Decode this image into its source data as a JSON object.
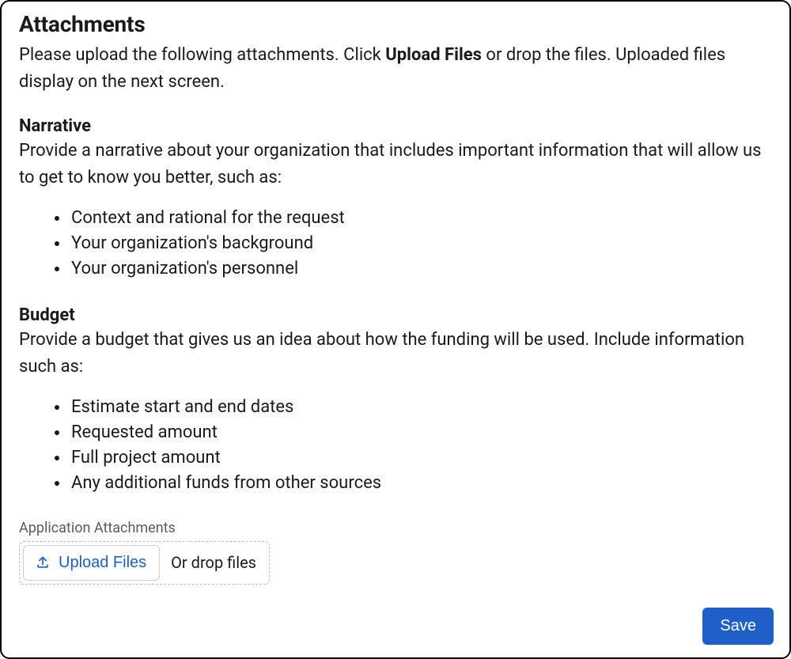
{
  "header": {
    "title": "Attachments",
    "intro_pre": "Please upload the following attachments. Click ",
    "intro_bold": "Upload Files",
    "intro_post": " or drop the files. Uploaded files display on the next screen."
  },
  "narrative": {
    "heading": "Narrative",
    "desc": "Provide a narrative about your organization that includes important information that will allow us to get to know you better, such as:",
    "bullets": [
      "Context and rational for the request",
      "Your organization's background",
      "Your organization's personnel"
    ]
  },
  "budget": {
    "heading": "Budget",
    "desc": "Provide a budget that gives us an idea about how the funding will be used. Include information such as:",
    "bullets": [
      "Estimate start and end dates",
      "Requested amount",
      "Full project amount",
      "Any additional funds from other sources"
    ]
  },
  "upload": {
    "field_label": "Application Attachments",
    "button_label": "Upload Files",
    "drop_text": "Or drop files"
  },
  "actions": {
    "save_label": "Save"
  },
  "colors": {
    "link": "#1b5fc1",
    "primary": "#1f5fc7"
  }
}
